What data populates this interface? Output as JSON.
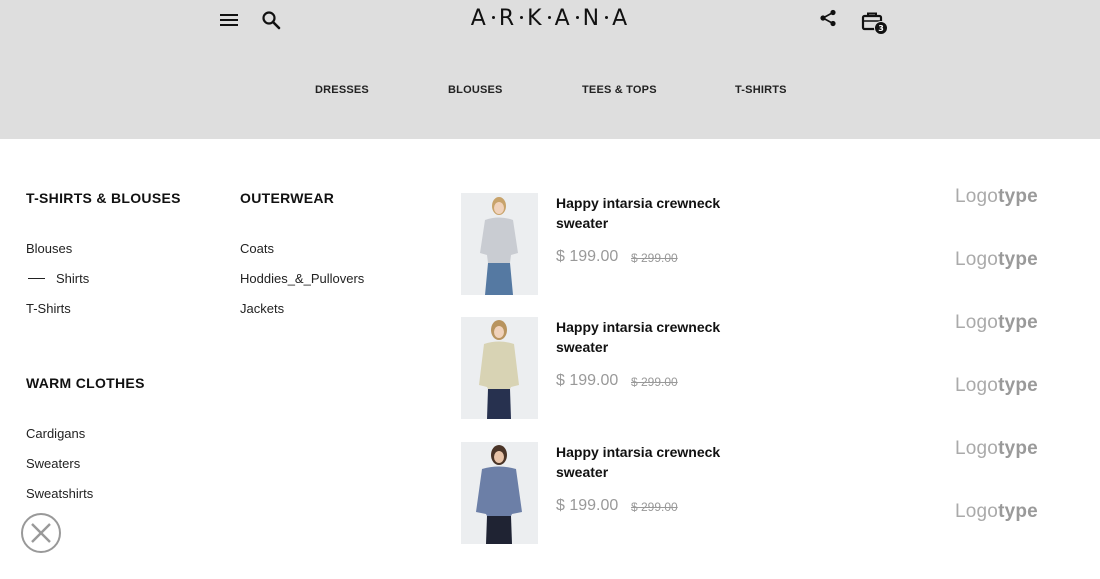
{
  "header": {
    "logo_letters": [
      "A",
      "R",
      "K",
      "A",
      "N",
      "A"
    ],
    "cart_count": "3",
    "icons": {
      "menu": "hamburger-menu-icon",
      "search": "search-icon",
      "share": "share-icon",
      "cart": "shopping-bag-icon"
    }
  },
  "categories": [
    "DRESSES",
    "BLOUSES",
    "TEES & TOPS",
    "T-SHIRTS"
  ],
  "menu": {
    "col1_heading": "T-SHIRTS & BLOUSES",
    "col1_items": [
      "Blouses",
      "Shirts",
      "T-Shirts"
    ],
    "col2_heading": "OUTERWEAR",
    "col2_items": [
      "Coats",
      "Hoddies_&_Pullovers",
      "Jackets"
    ],
    "col3_heading": "WARM CLOTHES",
    "col3_items": [
      "Cardigans",
      "Sweaters",
      "Sweatshirts"
    ],
    "active_item": "Shirts"
  },
  "products": [
    {
      "title": "Happy intarsia crewneck sweater",
      "price": "$ 199.00",
      "old_price": "$ 299.00",
      "sweater_color": "#c9ccd2"
    },
    {
      "title": "Happy intarsia crewneck sweater",
      "price": "$ 199.00",
      "old_price": "$ 299.00",
      "sweater_color": "#d8d3b4"
    },
    {
      "title": "Happy intarsia crewneck sweater",
      "price": "$ 199.00",
      "old_price": "$ 299.00",
      "sweater_color": "#6c7fa7"
    }
  ],
  "brands": [
    {
      "light": "Logo",
      "bold": "type"
    },
    {
      "light": "Logo",
      "bold": "type"
    },
    {
      "light": "Logo",
      "bold": "type"
    },
    {
      "light": "Logo",
      "bold": "type"
    },
    {
      "light": "Logo",
      "bold": "type"
    },
    {
      "light": "Logo",
      "bold": "type"
    }
  ]
}
